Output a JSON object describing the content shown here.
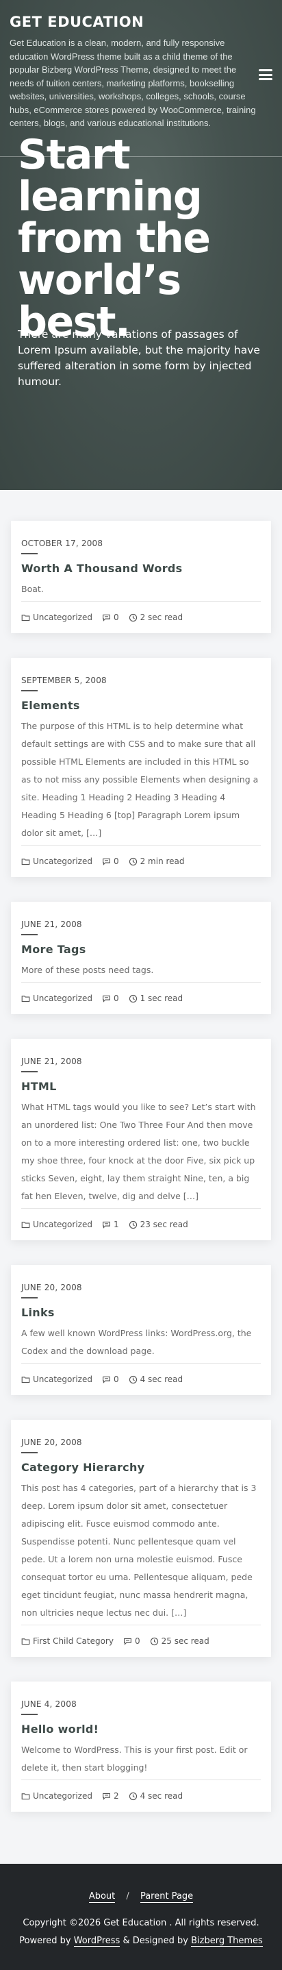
{
  "site": {
    "title": "GET EDUCATION",
    "description": "Get Education is a clean, modern, and fully responsive education WordPress theme built as a child theme of the popular Bizberg WordPress Theme, designed to meet the needs of tuition centers, marketing platforms, bookselling websites, universities, workshops, colleges, schools, course hubs, eCommerce stores powered by WooCommerce, training centers, blogs, and various educational institutions."
  },
  "hero": {
    "heading": "Start learning from the world’s best.",
    "text": "There are many variations of passages of Lorem Ipsum available, but the majority have suffered alteration in some form by injected humour."
  },
  "icons": {
    "menu": "hamburger-menu-icon",
    "category": "folder-icon",
    "comments": "comment-icon",
    "read_time": "clock-icon"
  },
  "colors": {
    "hero_bg": "#45524f",
    "footer_bg": "#232629",
    "title_text": "#3e4a48"
  },
  "posts": [
    {
      "date": "OCTOBER 17, 2008",
      "title": "Worth A Thousand Words",
      "excerpt": "Boat.",
      "category": "Uncategorized",
      "comments": "0",
      "read_time": "2 sec read"
    },
    {
      "date": "SEPTEMBER 5, 2008",
      "title": "Elements",
      "excerpt": "The purpose of this HTML is to help determine what default settings are with CSS and to make sure that all possible HTML Elements are included in this HTML so as to not miss any possible Elements when designing a site. Heading 1 Heading 2 Heading 3 Heading 4 Heading 5 Heading 6 [top] Paragraph Lorem ipsum dolor sit amet, […]",
      "category": "Uncategorized",
      "comments": "0",
      "read_time": "2 min read"
    },
    {
      "date": "JUNE 21, 2008",
      "title": "More Tags",
      "excerpt": "More of these posts need tags.",
      "category": "Uncategorized",
      "comments": "0",
      "read_time": "1 sec read"
    },
    {
      "date": "JUNE 21, 2008",
      "title": "HTML",
      "excerpt": "What HTML tags would you like to see? Let’s start with an unordered list: One Two Three Four And then move on to a more interesting ordered list: one, two buckle my shoe three, four knock at the door Five, six pick up sticks Seven, eight, lay them straight Nine, ten, a big fat hen Eleven, twelve, dig and delve […]",
      "category": "Uncategorized",
      "comments": "1",
      "read_time": "23 sec read"
    },
    {
      "date": "JUNE 20, 2008",
      "title": "Links",
      "excerpt": "A few well known WordPress links: WordPress.org, the Codex and the download page.",
      "category": "Uncategorized",
      "comments": "0",
      "read_time": "4 sec read"
    },
    {
      "date": "JUNE 20, 2008",
      "title": "Category Hierarchy",
      "excerpt": "This post has 4 categories, part of a hierarchy that is 3 deep. Lorem ipsum dolor sit amet, consectetuer adipiscing elit. Fusce euismod commodo ante. Suspendisse potenti. Nunc pellentesque quam vel pede. Ut a lorem non urna molestie euismod. Fusce consequat tortor eu urna. Pellentesque aliquam, pede eget tincidunt feugiat, nunc massa hendrerit magna, non ultricies neque lectus nec dui. […]",
      "category": "First Child Category",
      "comments": "0",
      "read_time": "25 sec read"
    },
    {
      "date": "JUNE 4, 2008",
      "title": "Hello world!",
      "excerpt": "Welcome to WordPress. This is your first post. Edit or delete it, then start blogging!",
      "category": "Uncategorized",
      "comments": "2",
      "read_time": "4 sec read"
    }
  ],
  "footer": {
    "nav": [
      "About",
      "Parent Page"
    ],
    "nav_separator": "/",
    "copyright": "Copyright ©2026 Get Education . All rights reserved.",
    "powered_prefix": "Powered by",
    "powered_wordpress": "WordPress",
    "powered_middle": "& Designed by",
    "powered_theme": "Bizberg Themes"
  }
}
